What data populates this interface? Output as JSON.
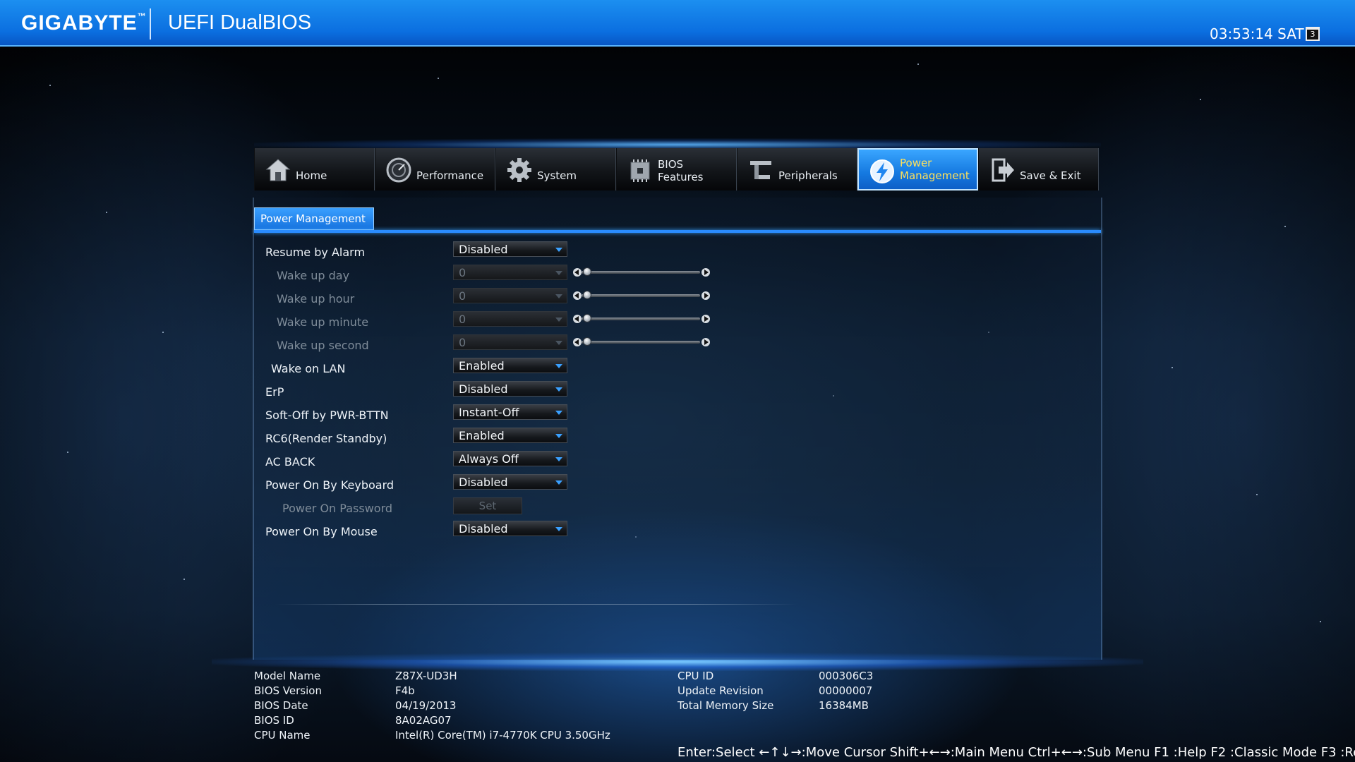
{
  "header": {
    "brand": "GIGABYTE",
    "trademark": "™",
    "product": "UEFI DualBIOS",
    "clock": "03:53:14 SAT",
    "calendar_day": "3"
  },
  "nav": {
    "home": "Home",
    "performance": "Performance",
    "system": "System",
    "bios_line1": "BIOS",
    "bios_line2": "Features",
    "peripherals": "Peripherals",
    "power_line1": "Power",
    "power_line2": "Management",
    "save_exit": "Save & Exit"
  },
  "sub_tab": "Power Management",
  "settings": [
    {
      "label": "Resume by Alarm",
      "value": "Disabled"
    },
    {
      "label": "Wake up day",
      "value": "0"
    },
    {
      "label": "Wake up hour",
      "value": "0"
    },
    {
      "label": "Wake up minute",
      "value": "0"
    },
    {
      "label": "Wake up second",
      "value": "0"
    },
    {
      "label": "Wake on LAN",
      "value": "Enabled"
    },
    {
      "label": "ErP",
      "value": "Disabled"
    },
    {
      "label": "Soft-Off by PWR-BTTN",
      "value": "Instant-Off"
    },
    {
      "label": "RC6(Render Standby)",
      "value": "Enabled"
    },
    {
      "label": "AC BACK",
      "value": "Always Off"
    },
    {
      "label": "Power On By Keyboard",
      "value": "Disabled"
    },
    {
      "label": "Power On Password",
      "value": "Set"
    },
    {
      "label": "Power On By Mouse",
      "value": "Disabled"
    }
  ],
  "system_info": {
    "left": [
      {
        "label": "Model Name",
        "value": "Z87X-UD3H"
      },
      {
        "label": "BIOS Version",
        "value": "F4b"
      },
      {
        "label": "BIOS Date",
        "value": "04/19/2013"
      },
      {
        "label": "BIOS ID",
        "value": "8A02AG07"
      },
      {
        "label": "CPU Name",
        "value": "Intel(R) Core(TM) i7-4770K CPU  3.50GHz"
      }
    ],
    "right": [
      {
        "label": "CPU ID",
        "value": "000306C3"
      },
      {
        "label": "Update Revision",
        "value": "00000007"
      },
      {
        "label": "Total Memory Size",
        "value": "16384MB"
      }
    ]
  },
  "help_bar": "Enter:Select ←↑↓→:Move Cursor Shift+←→:Main Menu Ctrl+←→:Sub Menu F1 :Help F2 :Classic Mode F3 :Re",
  "colors": {
    "header_blue": "#0b6fe0",
    "active_tab": "#1579e0",
    "active_label": "#ffe15a",
    "accent": "#2a8cff"
  }
}
